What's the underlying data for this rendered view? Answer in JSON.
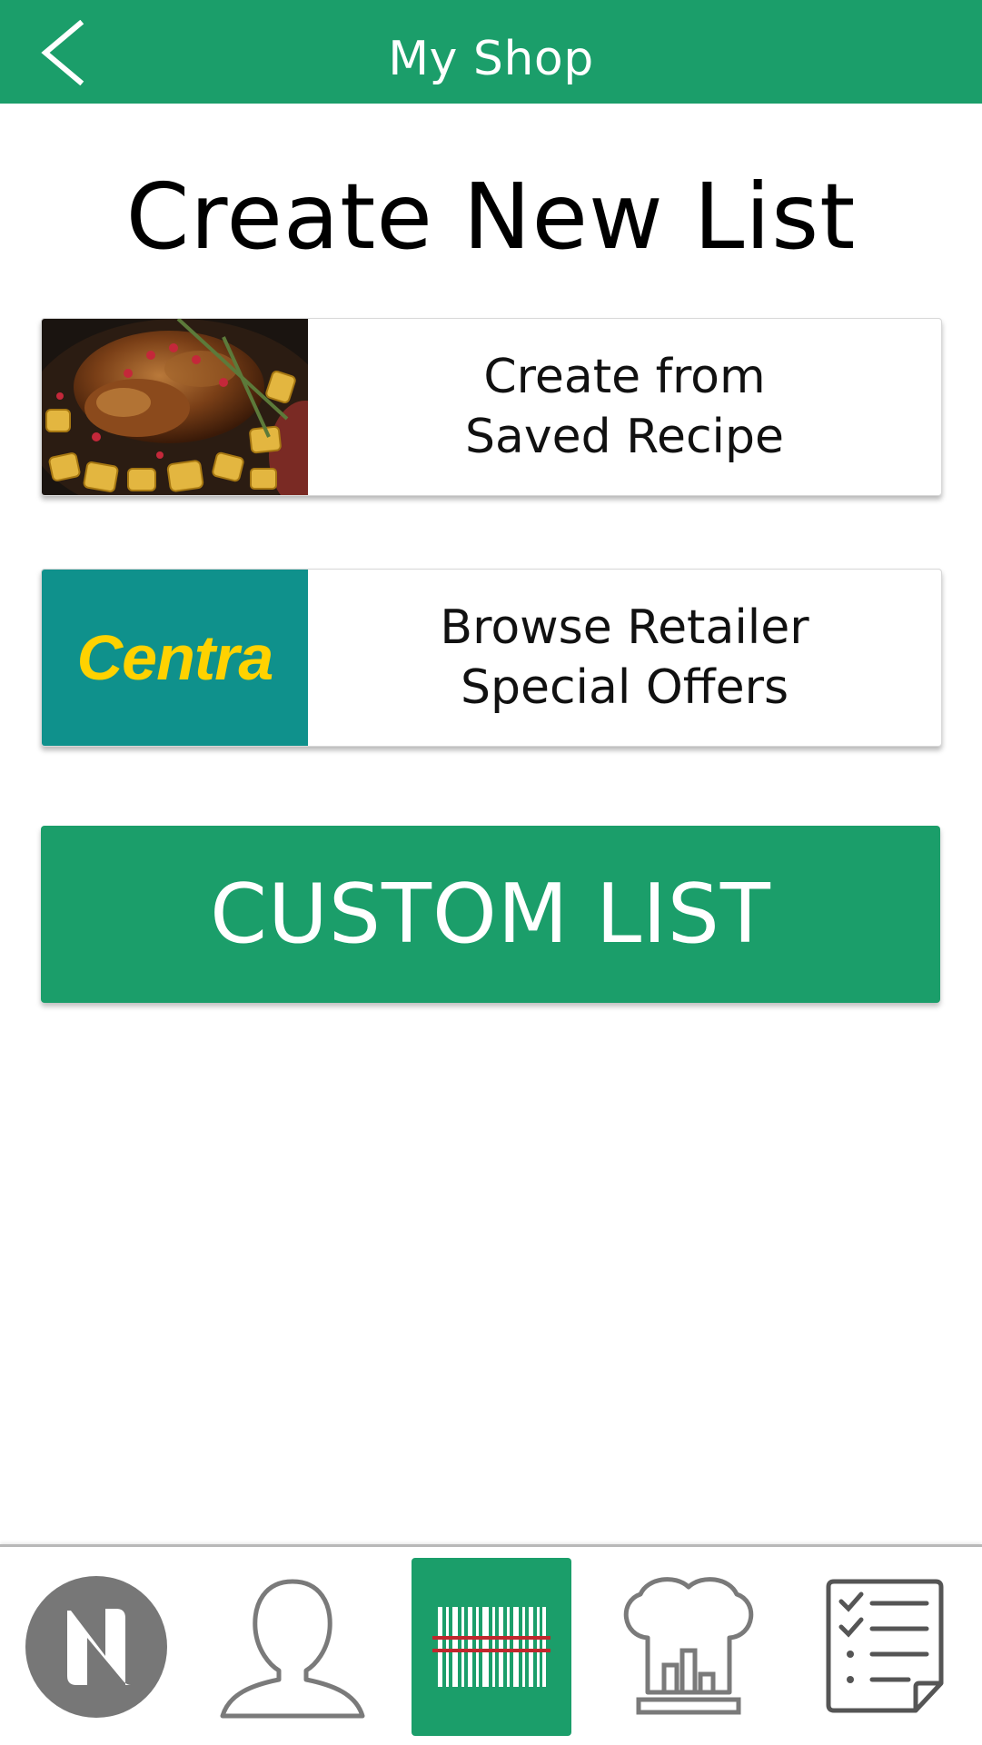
{
  "header": {
    "title": "My Shop",
    "back_icon": "chevron-left-icon",
    "background": "#1b9e6a"
  },
  "main": {
    "title": "Create New List",
    "options": [
      {
        "line1": "Create from",
        "line2": "Saved Recipe",
        "thumb": "roast-chicken-image"
      },
      {
        "line1": "Browse Retailer",
        "line2": "Special Offers",
        "thumb": "centra-logo",
        "logo_text": "Centra",
        "logo_color": "#ffd200",
        "logo_bg": "#0f918c"
      }
    ],
    "custom_button": "CUSTOM LIST"
  },
  "bottom_nav": {
    "items": [
      {
        "icon": "app-logo-icon",
        "active": false
      },
      {
        "icon": "profile-icon",
        "active": false
      },
      {
        "icon": "barcode-scan-icon",
        "active": true
      },
      {
        "icon": "chef-hat-icon",
        "active": false
      },
      {
        "icon": "checklist-icon",
        "active": false
      }
    ]
  }
}
